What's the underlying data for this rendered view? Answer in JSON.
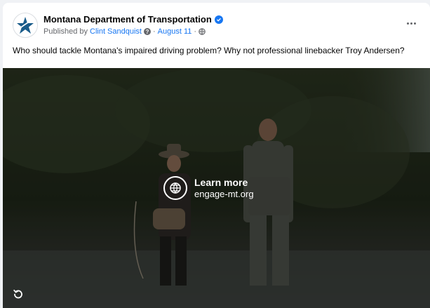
{
  "post": {
    "page_name": "Montana Department of Transportation",
    "verified": true,
    "published_by_prefix": "Published by",
    "author": "Clint Sandquist",
    "date": "August 11",
    "separator": "·",
    "caption": "Who should tackle Montana's impaired driving problem? Why not professional linebacker Troy Andersen?"
  },
  "media": {
    "cta_title": "Learn more",
    "cta_url": "engage-mt.org"
  },
  "icons": {
    "avatar": "mdt-star-logo",
    "verified": "verified-badge-icon",
    "info": "info-icon",
    "audience": "globe-icon",
    "more": "more-options-icon",
    "cta": "globe-icon",
    "replay": "replay-icon"
  },
  "colors": {
    "accent": "#1877f2",
    "logo": "#1a5c8a",
    "text": "#050505",
    "secondary": "#65676b"
  }
}
